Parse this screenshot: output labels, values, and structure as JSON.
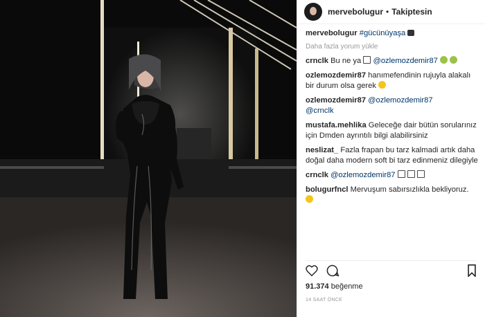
{
  "header": {
    "username": "mervebolugur",
    "separator": "•",
    "follow_label": "Takiptesin"
  },
  "caption": {
    "user": "mervebolugur",
    "text": "#gücünüyaşa",
    "emoji": "clapperboard-icon"
  },
  "load_more": "Daha fazla yorum yükle",
  "comments": [
    {
      "user": "crnclk",
      "text": "Bu ne ya",
      "mention": "@ozlemozdemir87"
    },
    {
      "user": "ozlemozdemir87",
      "text": "hanımefendinin rujuyla alakalı bir durum olsa gerek"
    },
    {
      "user": "ozlemozdemir87",
      "mention": "@ozlemozdemir87",
      "mention2": "@crnclk"
    },
    {
      "user": "mustafa.mehlika",
      "text": "Geleceğe dair bütün sorularınız için Dmden ayrıntılı bilgi alabilirsiniz"
    },
    {
      "user": "neslizat_",
      "text": "Fazla frapan bu tarz kalmadi artık daha doğal daha modern soft bi tarz edinmeniz dilegiyle"
    },
    {
      "user": "crnclk",
      "mention": "@ozlemozdemir87"
    },
    {
      "user": "bolugurfncl",
      "text": "Mervuşum sabırsızlıkla bekliyoruz."
    }
  ],
  "likes": {
    "count": "91.374",
    "label": "beğenme"
  },
  "timestamp": "14 SAAT ÖNCE",
  "colors": {
    "text": "#262626",
    "mention": "#003569",
    "muted": "#999999"
  }
}
